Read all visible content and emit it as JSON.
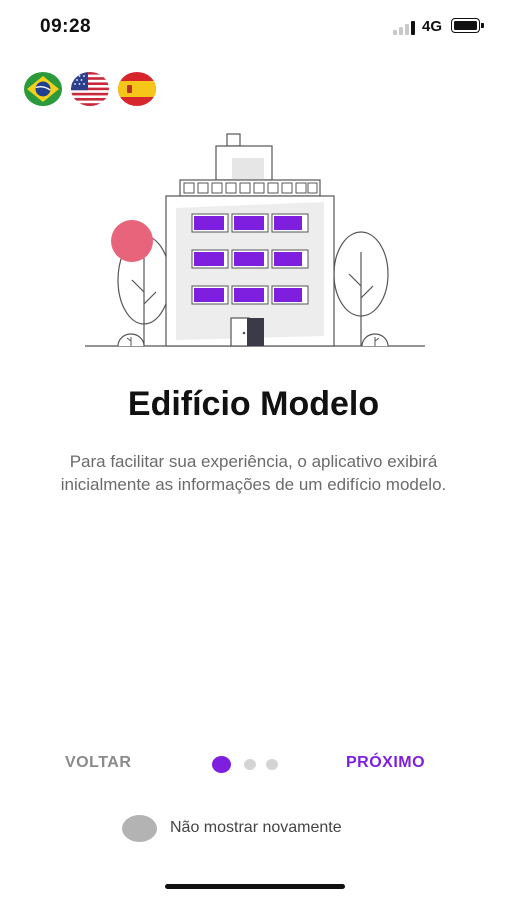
{
  "status_bar": {
    "time": "09:28",
    "network": "4G"
  },
  "languages": [
    {
      "name": "brazil-flag-icon"
    },
    {
      "name": "usa-flag-icon"
    },
    {
      "name": "spain-flag-icon"
    }
  ],
  "colors": {
    "accent": "#7e1fe0",
    "muted": "#8a8a8a",
    "pink": "#e8647a",
    "text": "#111111"
  },
  "illustration": {
    "icon": "building-icon"
  },
  "onboarding": {
    "title": "Edifício Modelo",
    "description": "Para facilitar sua experiência, o aplicativo exibirá inicialmente as informações de um edifício modelo.",
    "back_label": "VOLTAR",
    "next_label": "PRÓXIMO",
    "current_page": 1,
    "total_pages": 3,
    "dont_show_again_label": "Não mostrar novamente"
  }
}
